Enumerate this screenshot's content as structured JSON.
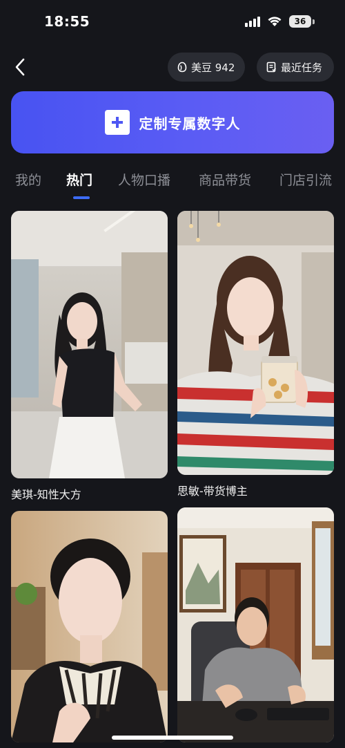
{
  "status_bar": {
    "time": "18:55",
    "battery": "36",
    "icons": [
      "signal-icon",
      "wifi-icon",
      "battery-icon"
    ]
  },
  "header": {
    "back_icon": "chevron-left-icon",
    "beans_label": "美豆 942",
    "beans_icon": "bean-icon",
    "tasks_label": "最近任务",
    "tasks_icon": "task-list-icon"
  },
  "create_banner": {
    "label": "定制专属数字人",
    "icon": "plus-icon",
    "accent": "#4e57f3"
  },
  "tabs": [
    {
      "label": "我的",
      "active": false
    },
    {
      "label": "热门",
      "active": true
    },
    {
      "label": "人物口播",
      "active": false
    },
    {
      "label": "商品带货",
      "active": false
    },
    {
      "label": "门店引流",
      "active": false
    }
  ],
  "cards": [
    {
      "label": "美琪-知性大方"
    },
    {
      "label": "思敏-带货博主"
    },
    {
      "label": ""
    },
    {
      "label": ""
    }
  ],
  "colors": {
    "background": "#15161b",
    "chip": "#2a2c33",
    "tab_active": "#ffffff",
    "tab_inactive": "#8d8f96",
    "tab_indicator": "#3d6cf6"
  }
}
